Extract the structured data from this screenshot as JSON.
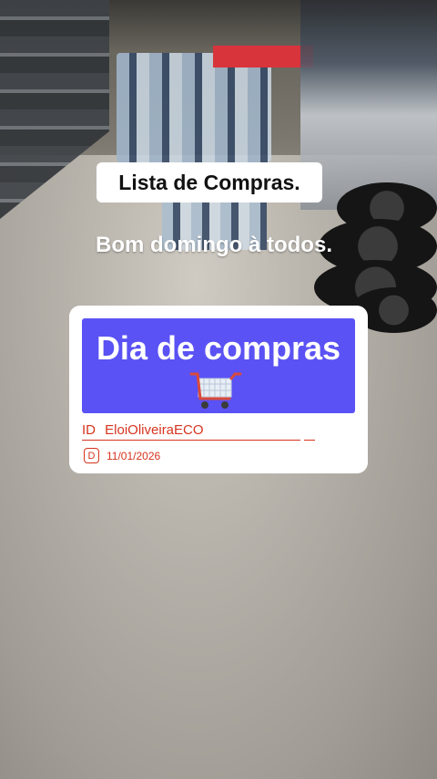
{
  "story": {
    "title": "Lista de Compras.",
    "greeting": "Bom domingo à todos.",
    "card": {
      "banner_text": "Dia de compras",
      "banner_color": "#5a52f4",
      "cart_icon": "shopping-cart-icon",
      "id_label": "ID",
      "id_value": "EloiOliveiraECO",
      "date_icon": "D",
      "date": "11/01/2026",
      "accent_color": "#d6341e"
    }
  }
}
